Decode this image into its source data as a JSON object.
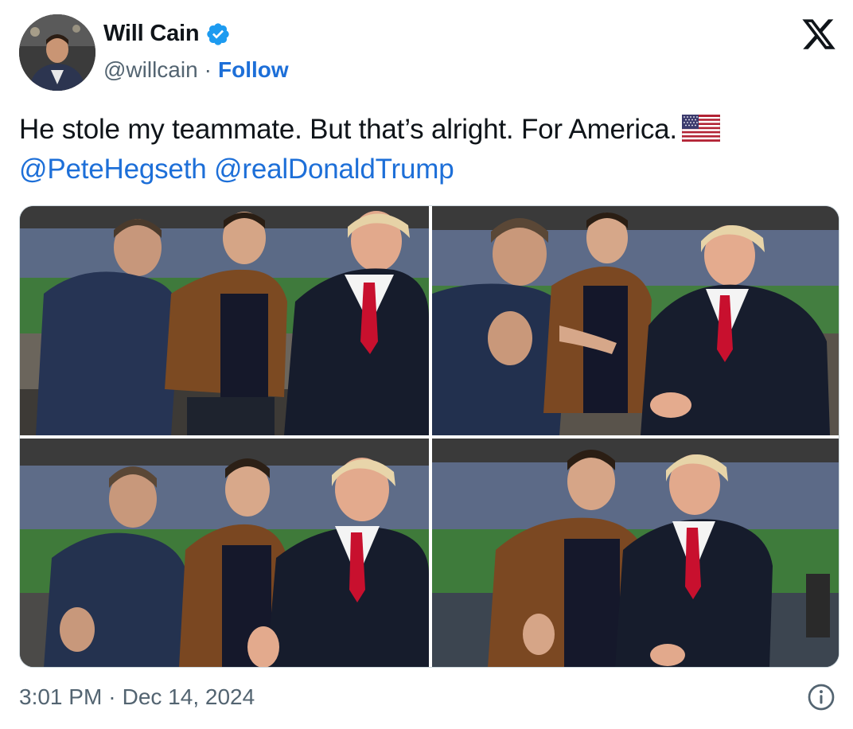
{
  "author": {
    "display_name": "Will Cain",
    "handle": "@willcain",
    "separator": "·",
    "follow_label": "Follow",
    "verified": true,
    "avatar_icon": "user-avatar"
  },
  "brand": {
    "logo_icon": "x-logo-icon",
    "accent_color": "#1d9bf0",
    "link_color": "#1d6fd8"
  },
  "tweet": {
    "text": "He stole my teammate. But that’s alright. For America.",
    "emoji_icon": "us-flag-icon",
    "mentions": [
      "@PeteHegseth",
      "@realDonaldTrump"
    ]
  },
  "media": {
    "photo_count": 4,
    "photos": [
      {
        "icon": "photo-three-men-talking"
      },
      {
        "icon": "photo-three-men-gesturing"
      },
      {
        "icon": "photo-three-men-thumbs-up"
      },
      {
        "icon": "photo-two-men-posing"
      }
    ]
  },
  "footer": {
    "time": "3:01 PM",
    "separator": "·",
    "date": "Dec 14, 2024",
    "info_icon": "info-icon"
  }
}
